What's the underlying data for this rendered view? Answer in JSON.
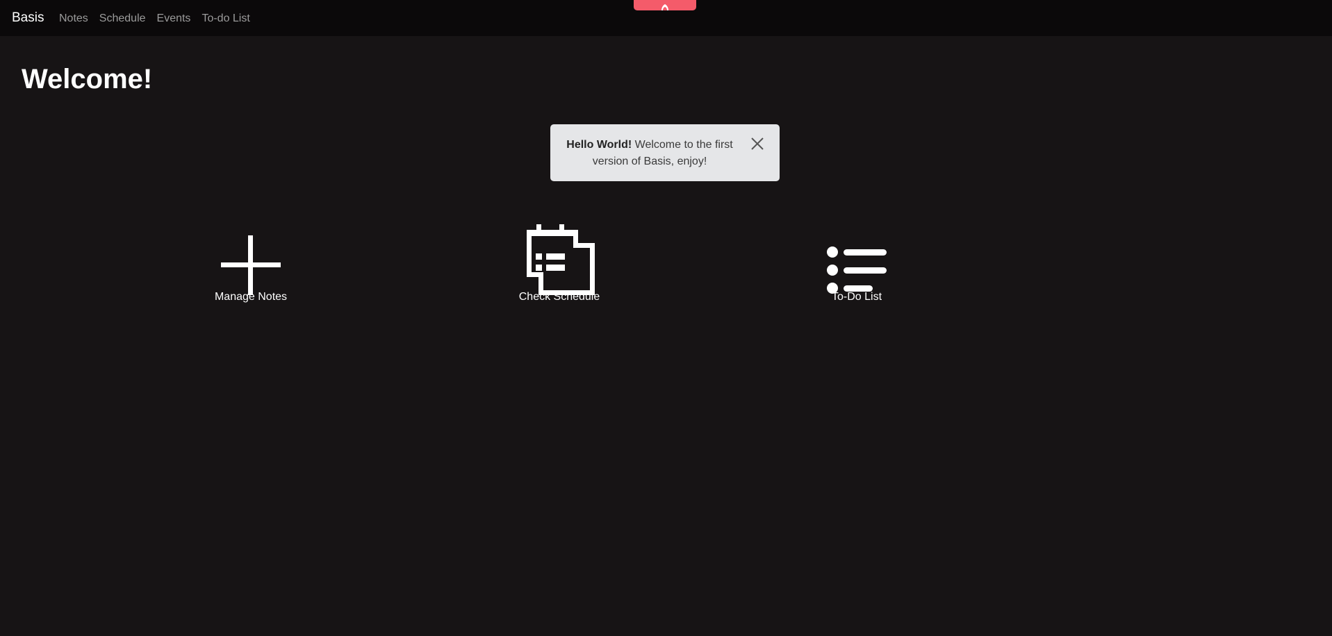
{
  "navbar": {
    "brand": "Basis",
    "links": [
      "Notes",
      "Schedule",
      "Events",
      "To-do List"
    ]
  },
  "page": {
    "title": "Welcome!"
  },
  "toast": {
    "strong": "Hello World!",
    "message": " Welcome to the first version of Basis, enjoy!"
  },
  "actions": [
    {
      "label": "Manage Notes",
      "icon": "plus-icon"
    },
    {
      "label": "Check Schedule",
      "icon": "calendar-icon"
    },
    {
      "label": "To-Do List",
      "icon": "list-icon"
    }
  ],
  "colors": {
    "background": "#171415",
    "navbar": "#0b090a",
    "toast_bg": "#e5e6e8",
    "dev_tab": "#f45b6a"
  }
}
